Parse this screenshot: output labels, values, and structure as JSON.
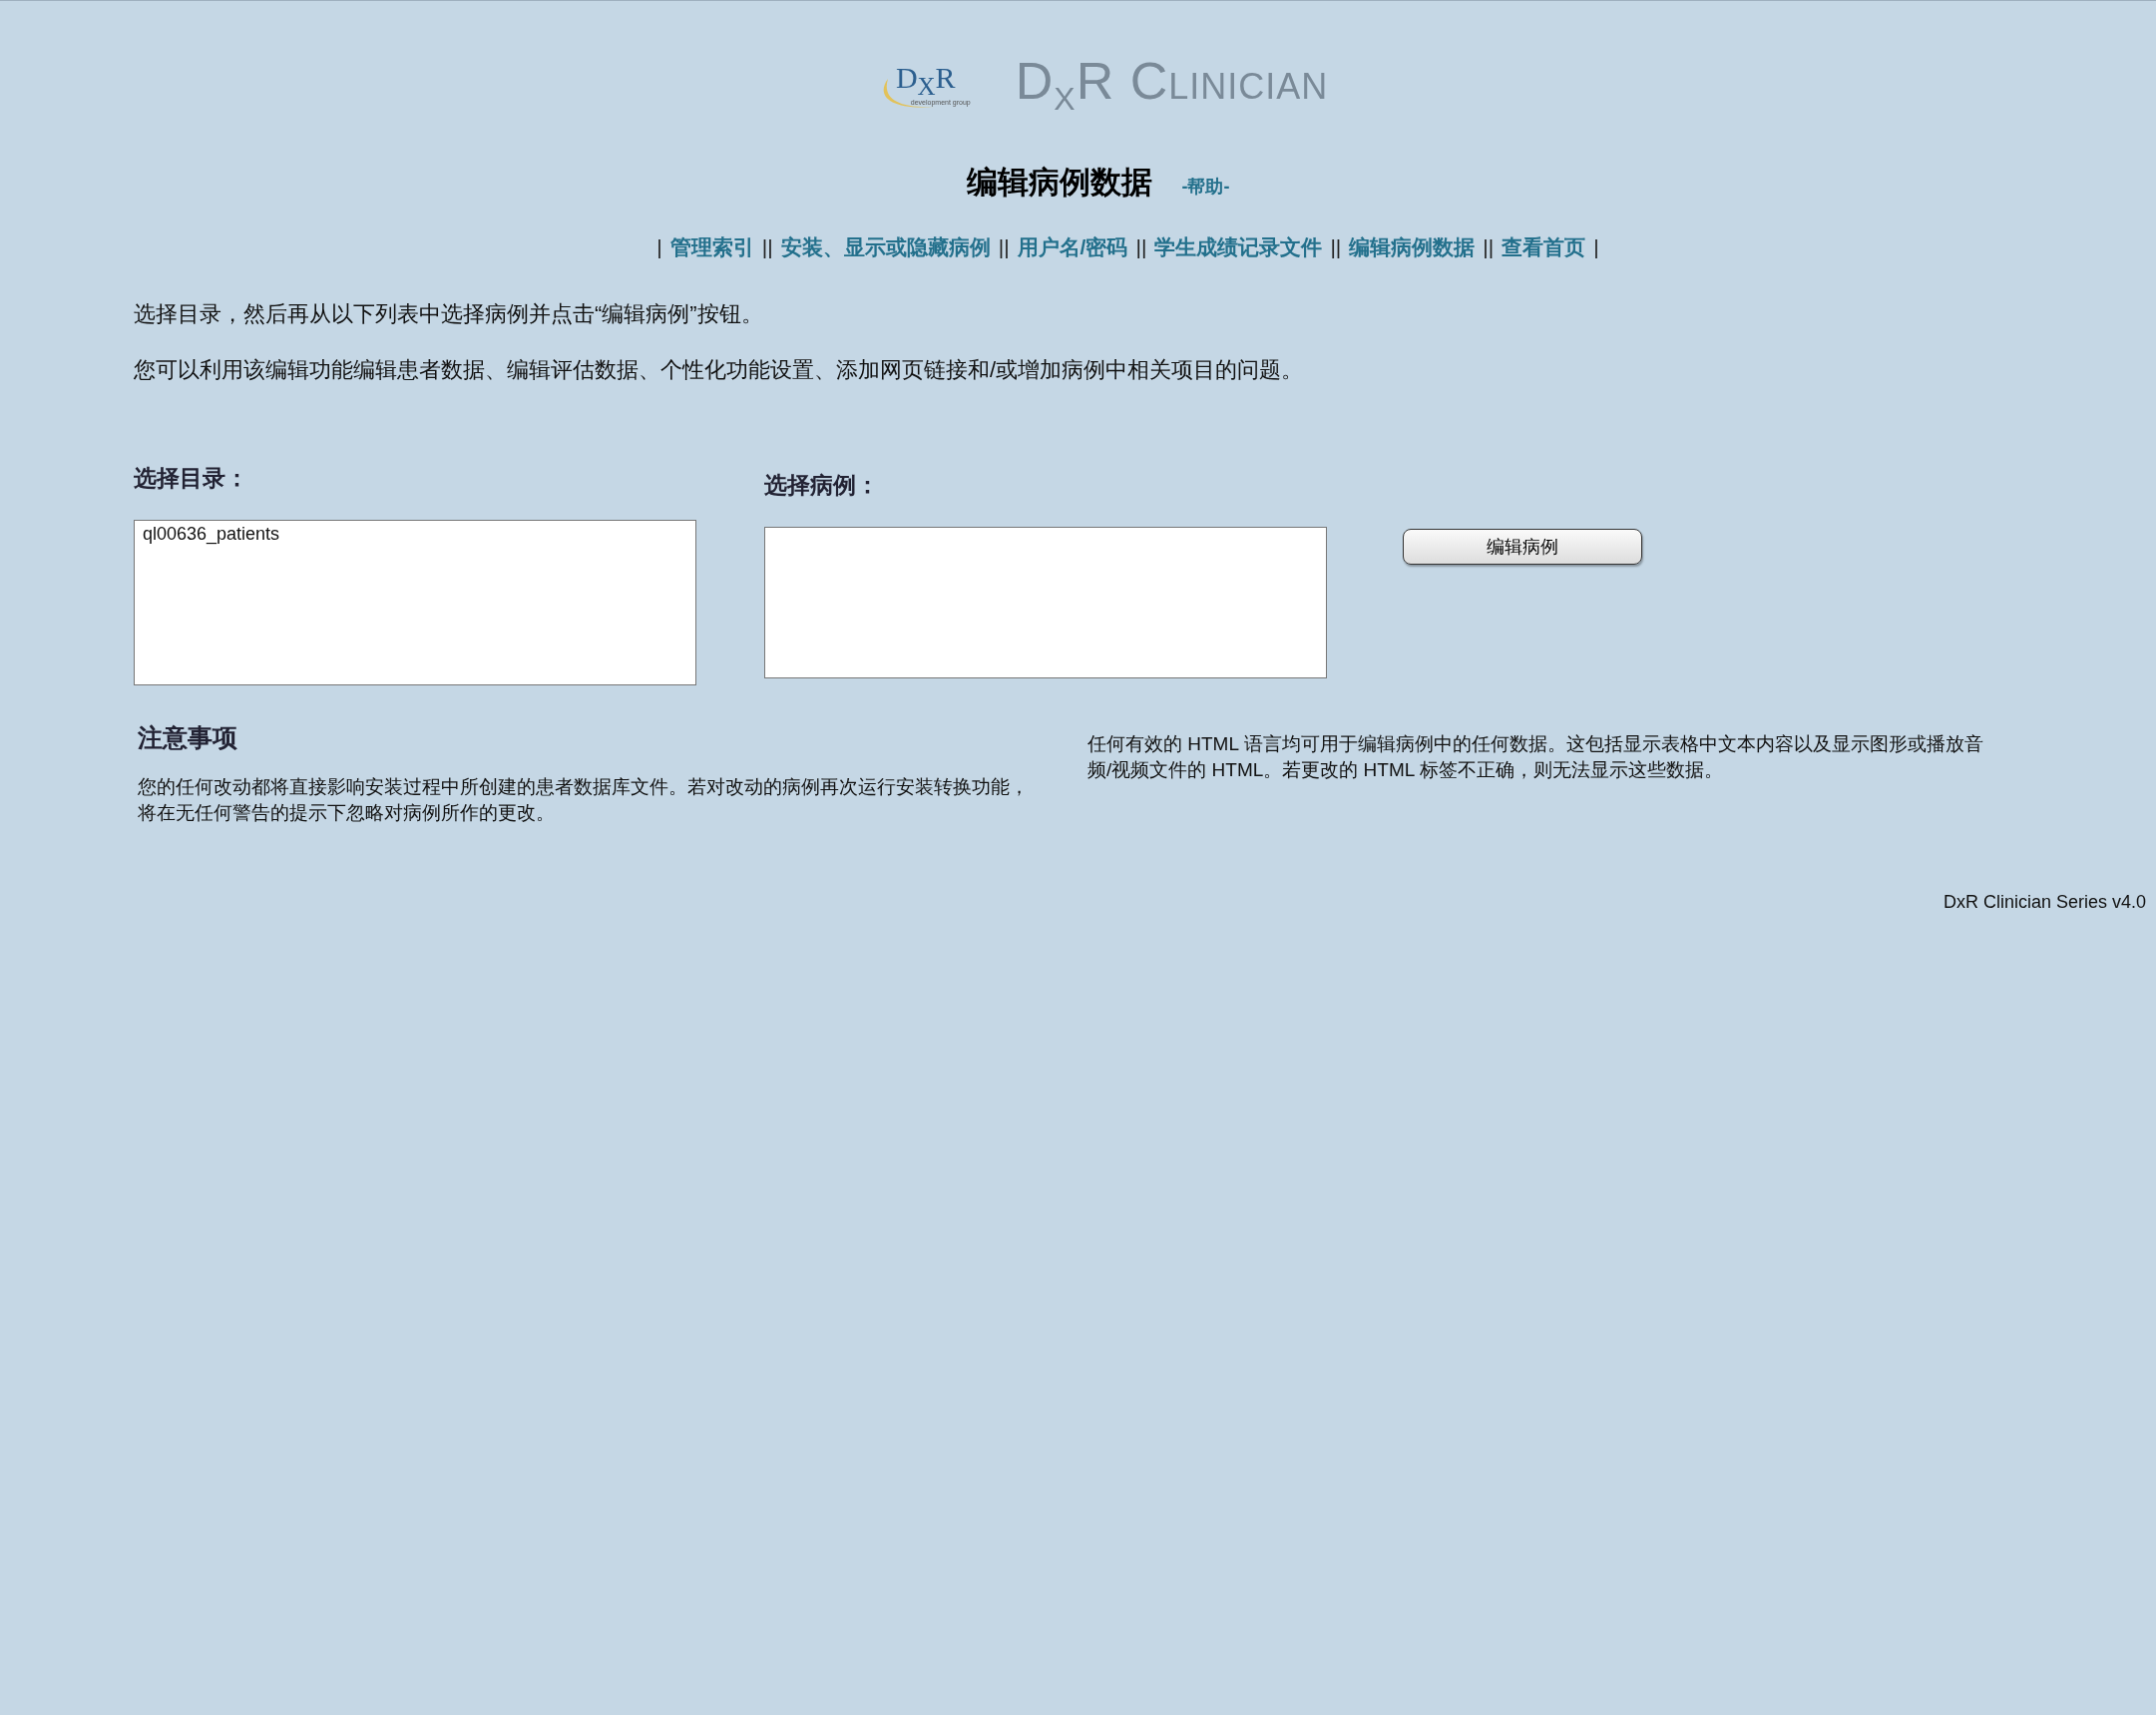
{
  "header": {
    "logo_mark": "D$_{X}$R",
    "logo_tagline": "development group",
    "logo_title": "D$_{X}$R Clinician"
  },
  "page": {
    "title": "编辑病例数据",
    "help_link": "-帮助-"
  },
  "nav": [
    {
      "kind": "separator",
      "text": "|"
    },
    {
      "kind": "link",
      "text": "管理索引"
    },
    {
      "kind": "separator",
      "text": "||"
    },
    {
      "kind": "link",
      "text": "安装、显示或隐藏病例"
    },
    {
      "kind": "separator",
      "text": "||"
    },
    {
      "kind": "link",
      "text": "用户名/密码"
    },
    {
      "kind": "separator",
      "text": "||"
    },
    {
      "kind": "link",
      "text": "学生成绩记录文件"
    },
    {
      "kind": "separator",
      "text": "||"
    },
    {
      "kind": "link",
      "text": "编辑病例数据"
    },
    {
      "kind": "separator",
      "text": "||"
    },
    {
      "kind": "link",
      "text": "查看首页"
    },
    {
      "kind": "separator",
      "text": "|"
    }
  ],
  "intro": [
    "选择目录，然后再从以下列表中选择病例并点击“编辑病例”按钮。",
    "您可以利用该编辑功能编辑患者数据、编辑评估数据、个性化功能设置、添加网页链接和/或增加病例中相关项目的问题。"
  ],
  "directory": {
    "label": "选择目录：",
    "options": [
      {
        "label": "ql00636_patients",
        "selected": false
      }
    ]
  },
  "case": {
    "label": "选择病例："
  },
  "edit_button": "编辑病例",
  "notes": {
    "title": "注意事项",
    "left": "您的任何改动都将直接影响安装过程中所创建的患者数据库文件。若对改动的病例再次运行安装转换功能，将在无任何警告的提示下忽略对病例所作的更改。",
    "right": "任何有效的 HTML 语言均可用于编辑病例中的任何数据。这包括显示表格中文本内容以及显示图形或播放音频/视频文件的 HTML。若更改的 HTML 标签不正确，则无法显示这些数据。"
  },
  "footer": "DxR Clinician Series v4.0"
}
